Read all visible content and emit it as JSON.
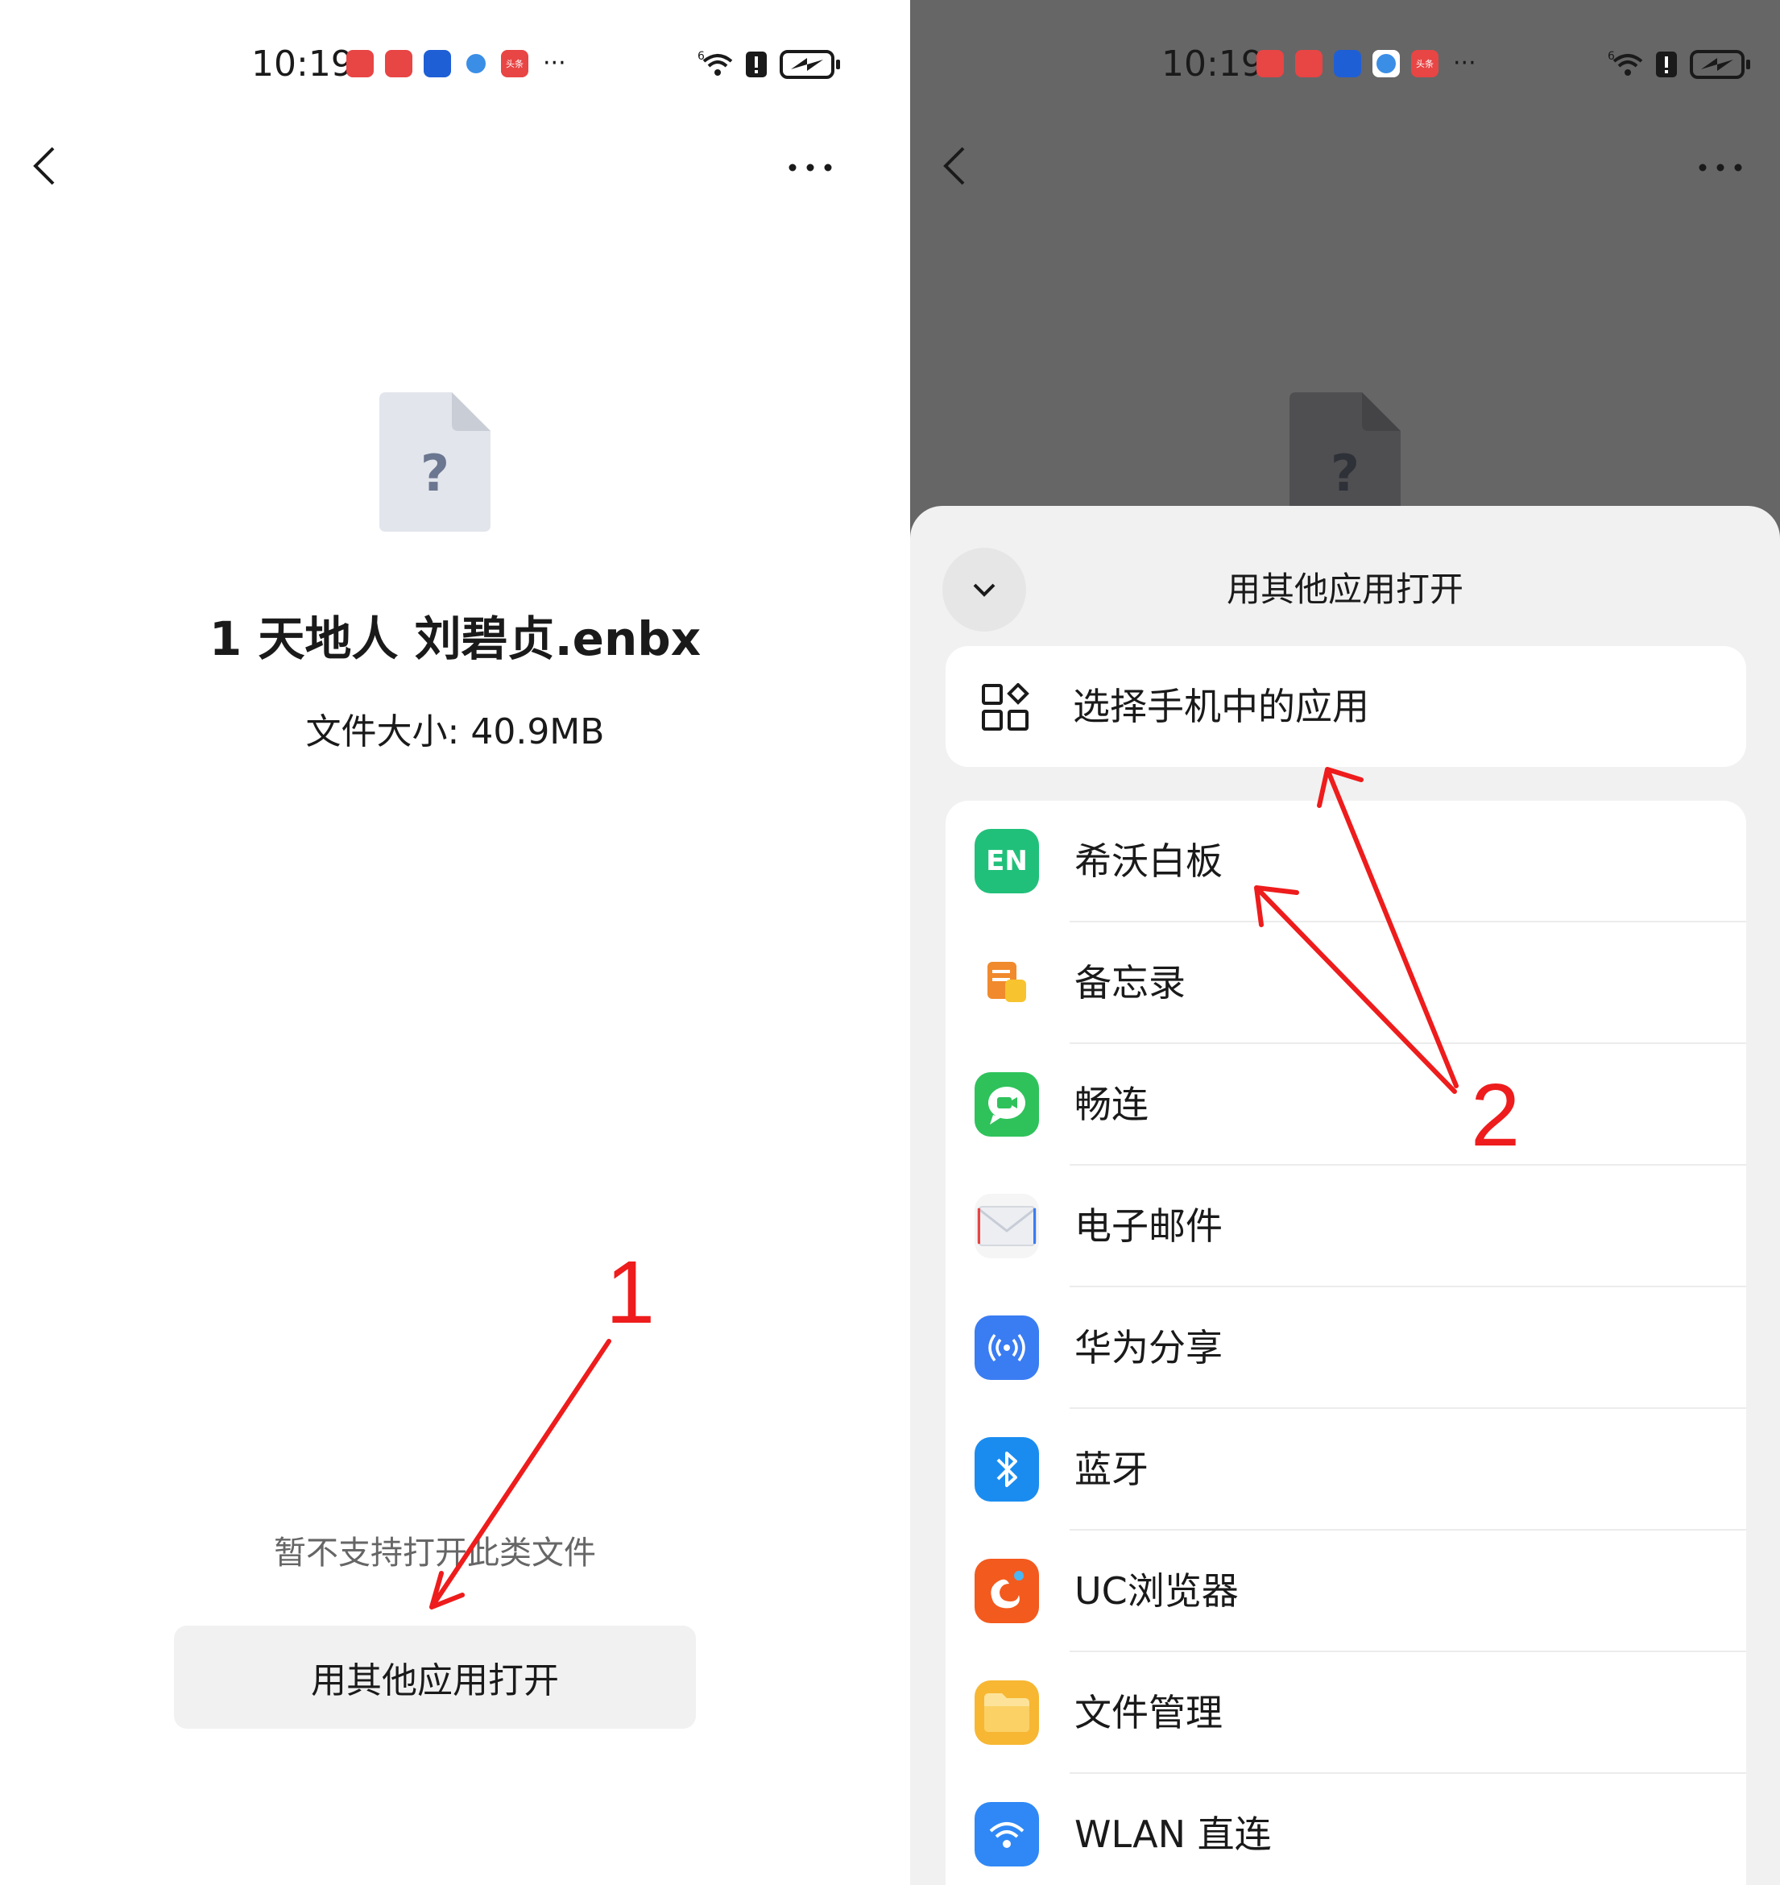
{
  "status_bar": {
    "time": "10:19",
    "network": "6",
    "more": "···",
    "badge_label": "头条"
  },
  "left_screen": {
    "file_name": "1 天地人 刘碧贞.enbx",
    "file_size": "文件大小: 40.9MB",
    "unsupported_text": "暂不支持打开此类文件",
    "open_button_label": "用其他应用打开",
    "file_icon_glyph": "?",
    "annotation_number": "1"
  },
  "right_screen": {
    "sheet_title": "用其他应用打开",
    "choose_app_label": "选择手机中的应用",
    "apps": [
      {
        "label": "希沃白板",
        "icon": "EN",
        "color": "#21c07a"
      },
      {
        "label": "备忘录",
        "icon": "memo-icon",
        "color": "#f08a2c"
      },
      {
        "label": "畅连",
        "icon": "chat-icon",
        "color": "#2fc25b"
      },
      {
        "label": "电子邮件",
        "icon": "mail-icon",
        "color": "#f5f5f5"
      },
      {
        "label": "华为分享",
        "icon": "share-icon",
        "color": "#3a7cf2"
      },
      {
        "label": "蓝牙",
        "icon": "bluetooth-icon",
        "color": "#1a8cf0"
      },
      {
        "label": "UC浏览器",
        "icon": "uc-icon",
        "color": "#f35a1e"
      },
      {
        "label": "文件管理",
        "icon": "folder-icon",
        "color": "#f7b733"
      },
      {
        "label": "WLAN 直连",
        "icon": "wlan-icon",
        "color": "#2f88f5"
      }
    ],
    "annotation_number": "2"
  },
  "colors": {
    "annotation": "#ee1c1c",
    "sheet_bg": "#f1f1f1",
    "overlay": "#666666"
  }
}
